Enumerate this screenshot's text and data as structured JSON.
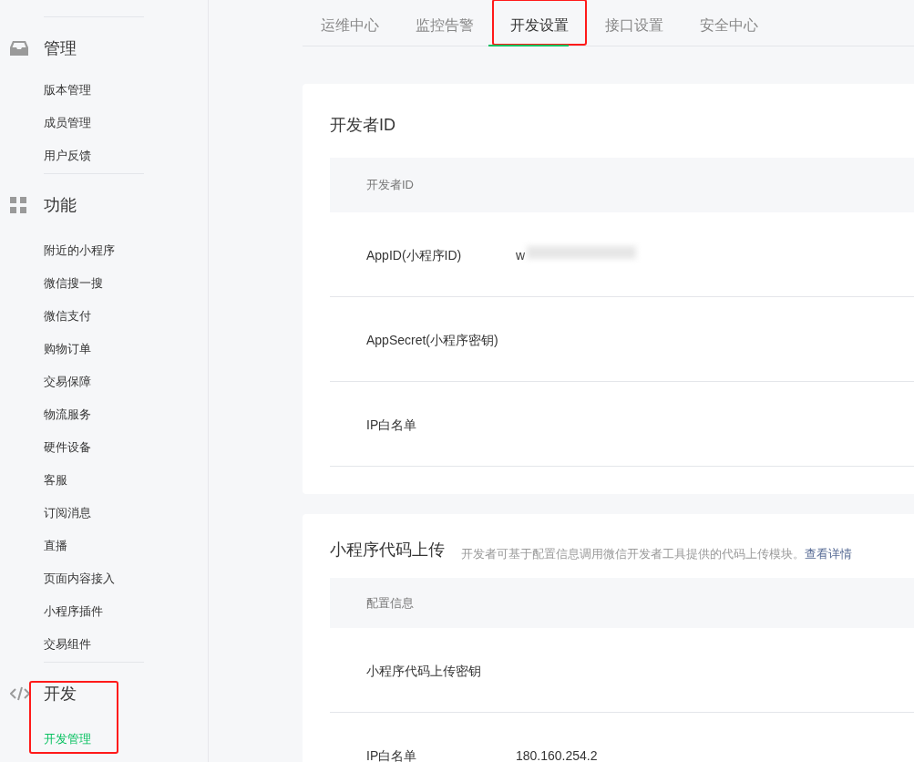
{
  "sidebar": {
    "sections": [
      {
        "title": "管理",
        "highlighted": false,
        "items": [
          {
            "label": "版本管理",
            "selected": false
          },
          {
            "label": "成员管理",
            "selected": false
          },
          {
            "label": "用户反馈",
            "selected": false
          }
        ]
      },
      {
        "title": "功能",
        "highlighted": false,
        "items": [
          {
            "label": "附近的小程序",
            "selected": false
          },
          {
            "label": "微信搜一搜",
            "selected": false
          },
          {
            "label": "微信支付",
            "selected": false
          },
          {
            "label": "购物订单",
            "selected": false
          },
          {
            "label": "交易保障",
            "selected": false
          },
          {
            "label": "物流服务",
            "selected": false
          },
          {
            "label": "硬件设备",
            "selected": false
          },
          {
            "label": "客服",
            "selected": false
          },
          {
            "label": "订阅消息",
            "selected": false
          },
          {
            "label": "直播",
            "selected": false
          },
          {
            "label": "页面内容接入",
            "selected": false
          },
          {
            "label": "小程序插件",
            "selected": false
          },
          {
            "label": "交易组件",
            "selected": false
          }
        ]
      },
      {
        "title": "开发",
        "highlighted": true,
        "items": [
          {
            "label": "开发管理",
            "selected": true
          }
        ]
      }
    ]
  },
  "tabs": [
    {
      "label": "运维中心",
      "selected": false,
      "highlighted": false
    },
    {
      "label": "监控告警",
      "selected": false,
      "highlighted": false
    },
    {
      "label": "开发设置",
      "selected": true,
      "highlighted": true
    },
    {
      "label": "接口设置",
      "selected": false,
      "highlighted": false
    },
    {
      "label": "安全中心",
      "selected": false,
      "highlighted": false
    }
  ],
  "cards": [
    {
      "title": "开发者ID",
      "header": "开发者ID",
      "rows": [
        {
          "label": "AppID(小程序ID)",
          "value": "w",
          "redacted": true
        },
        {
          "label": "AppSecret(小程序密钥)"
        },
        {
          "label": "IP白名单"
        }
      ]
    },
    {
      "title": "小程序代码上传",
      "description": "开发者可基于配置信息调用微信开发者工具提供的代码上传模块。",
      "link": "查看详情",
      "header": "配置信息",
      "rows": [
        {
          "label": "小程序代码上传密钥"
        },
        {
          "label": "IP白名单",
          "value": "180.160.254.2"
        }
      ]
    }
  ]
}
